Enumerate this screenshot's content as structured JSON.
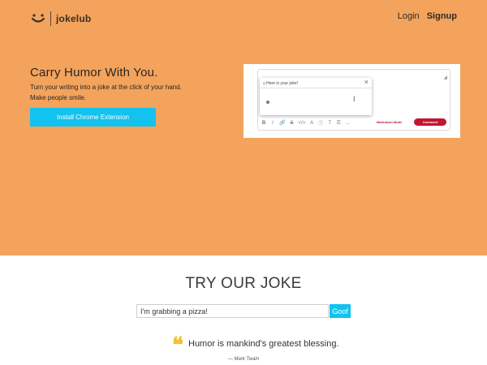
{
  "header": {
    "logo_text": "jokelub",
    "nav": {
      "login": "Login",
      "signup": "Signup"
    }
  },
  "hero": {
    "title": "Carry Humor With You.",
    "subtitle_lines": [
      "Turn your writing into a joke at the click of your hand.",
      "Make people smile."
    ],
    "cta_label": "Install Chrome Extension"
  },
  "preview": {
    "popup_title": "Here is your joke!",
    "toolbar": [
      "B",
      "I",
      "link",
      "S",
      "code",
      "A",
      "i",
      "T",
      "list",
      "..."
    ],
    "markdown_label": "Markdown Mode",
    "comment_label": "Comment"
  },
  "try_section": {
    "title": "TRY OUR JOKE",
    "input_value": "I'm grabbing a pizza!",
    "button_label": "Goof"
  },
  "quote": {
    "mark": "❝",
    "text": "Humor is mankind's greatest blessing.",
    "dash": "—",
    "author": "Mark Twain"
  },
  "colors": {
    "hero_bg": "#f3a35c",
    "accent": "#12c2ef",
    "quote_mark": "#f1c232",
    "comment_btn": "#c31432"
  }
}
